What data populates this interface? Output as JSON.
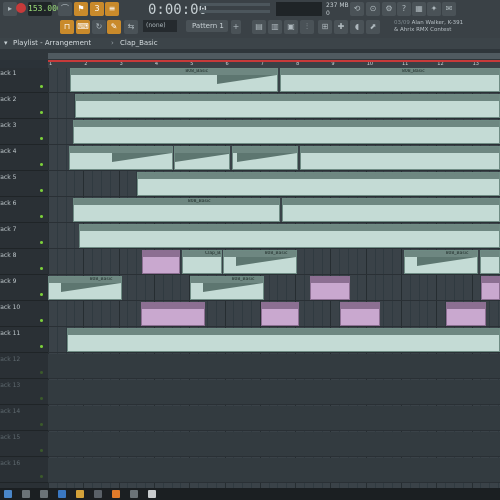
{
  "toolbar": {
    "tempo": "153.000",
    "time": "0:00:00",
    "pattern": "Pattern 1",
    "none_select": "(none)",
    "memory": "237 MB",
    "cpu": "0",
    "news_date": "03/09",
    "news_text": "Alan Walker, K-391 & Ahrix RMX Contest",
    "buttons": [
      "pat-song-toggle",
      "record",
      "play",
      "stop"
    ]
  },
  "playlist": {
    "title": "Playlist - Arrangement",
    "breadcrumb_sep": "›",
    "current_clip": "Clap_Basic"
  },
  "ruler": {
    "bars": [
      "1",
      "2",
      "3",
      "4",
      "5",
      "6",
      "7",
      "8",
      "9",
      "10",
      "11",
      "12",
      "13"
    ]
  },
  "tracks": [
    {
      "name": "Track 1",
      "active": true
    },
    {
      "name": "Track 2",
      "active": true
    },
    {
      "name": "Track 3",
      "active": true
    },
    {
      "name": "Track 4",
      "active": true
    },
    {
      "name": "Track 5",
      "active": true
    },
    {
      "name": "Track 6",
      "active": true
    },
    {
      "name": "Track 7",
      "active": true
    },
    {
      "name": "Track 8",
      "active": true
    },
    {
      "name": "Track 9",
      "active": true
    },
    {
      "name": "Track 10",
      "active": true
    },
    {
      "name": "Track 11",
      "active": true
    },
    {
      "name": "Track 12",
      "active": false
    },
    {
      "name": "Track 13",
      "active": false
    },
    {
      "name": "Track 14",
      "active": false
    },
    {
      "name": "Track 15",
      "active": false
    },
    {
      "name": "Track 16",
      "active": false
    }
  ],
  "clip_labels": {
    "bd": "808_Basic",
    "clap": "Clap_Basic"
  },
  "colors": {
    "accent": "#c98a2b",
    "record": "#c73a3a",
    "clip_pattern": "#b9d3cc",
    "clip_audio": "#c9a8cf",
    "track_active_dot": "#7ccf3a"
  }
}
